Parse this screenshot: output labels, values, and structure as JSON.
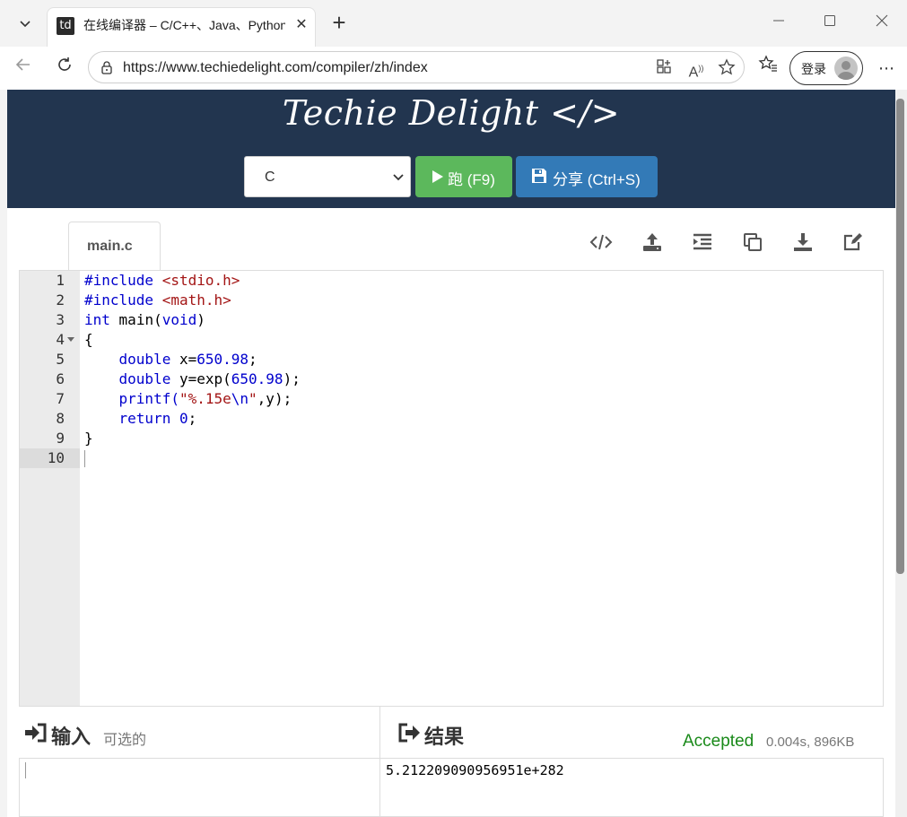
{
  "browser": {
    "tab": {
      "favicon_text": "td",
      "title": "在线编译器 – C/C++、Java、Python"
    },
    "address": {
      "url": "https://www.techiedelight.com/compiler/zh/index"
    },
    "profile": {
      "login_label": "登录"
    }
  },
  "header": {
    "brand": "Techie Delight </>",
    "language": {
      "selected": "C"
    },
    "run_button": {
      "label": "跑 (F9)"
    },
    "share_button": {
      "label": "分享 (Ctrl+S)"
    }
  },
  "editor": {
    "file_tab": "main.c",
    "line_numbers": [
      "1",
      "2",
      "3",
      "4",
      "5",
      "6",
      "7",
      "8",
      "9",
      "10"
    ],
    "active_line": "10"
  },
  "io": {
    "input": {
      "title": "输入",
      "optional_note": "可选的"
    },
    "result": {
      "title": "结果",
      "status": "Accepted",
      "meta": "0.004s, 896KB",
      "output": "5.212209090956951e+282"
    }
  },
  "colors": {
    "header_bg": "#22354f",
    "run_green": "#5cb85c",
    "share_blue": "#337ab7",
    "accepted_green": "#1a8a1a"
  }
}
